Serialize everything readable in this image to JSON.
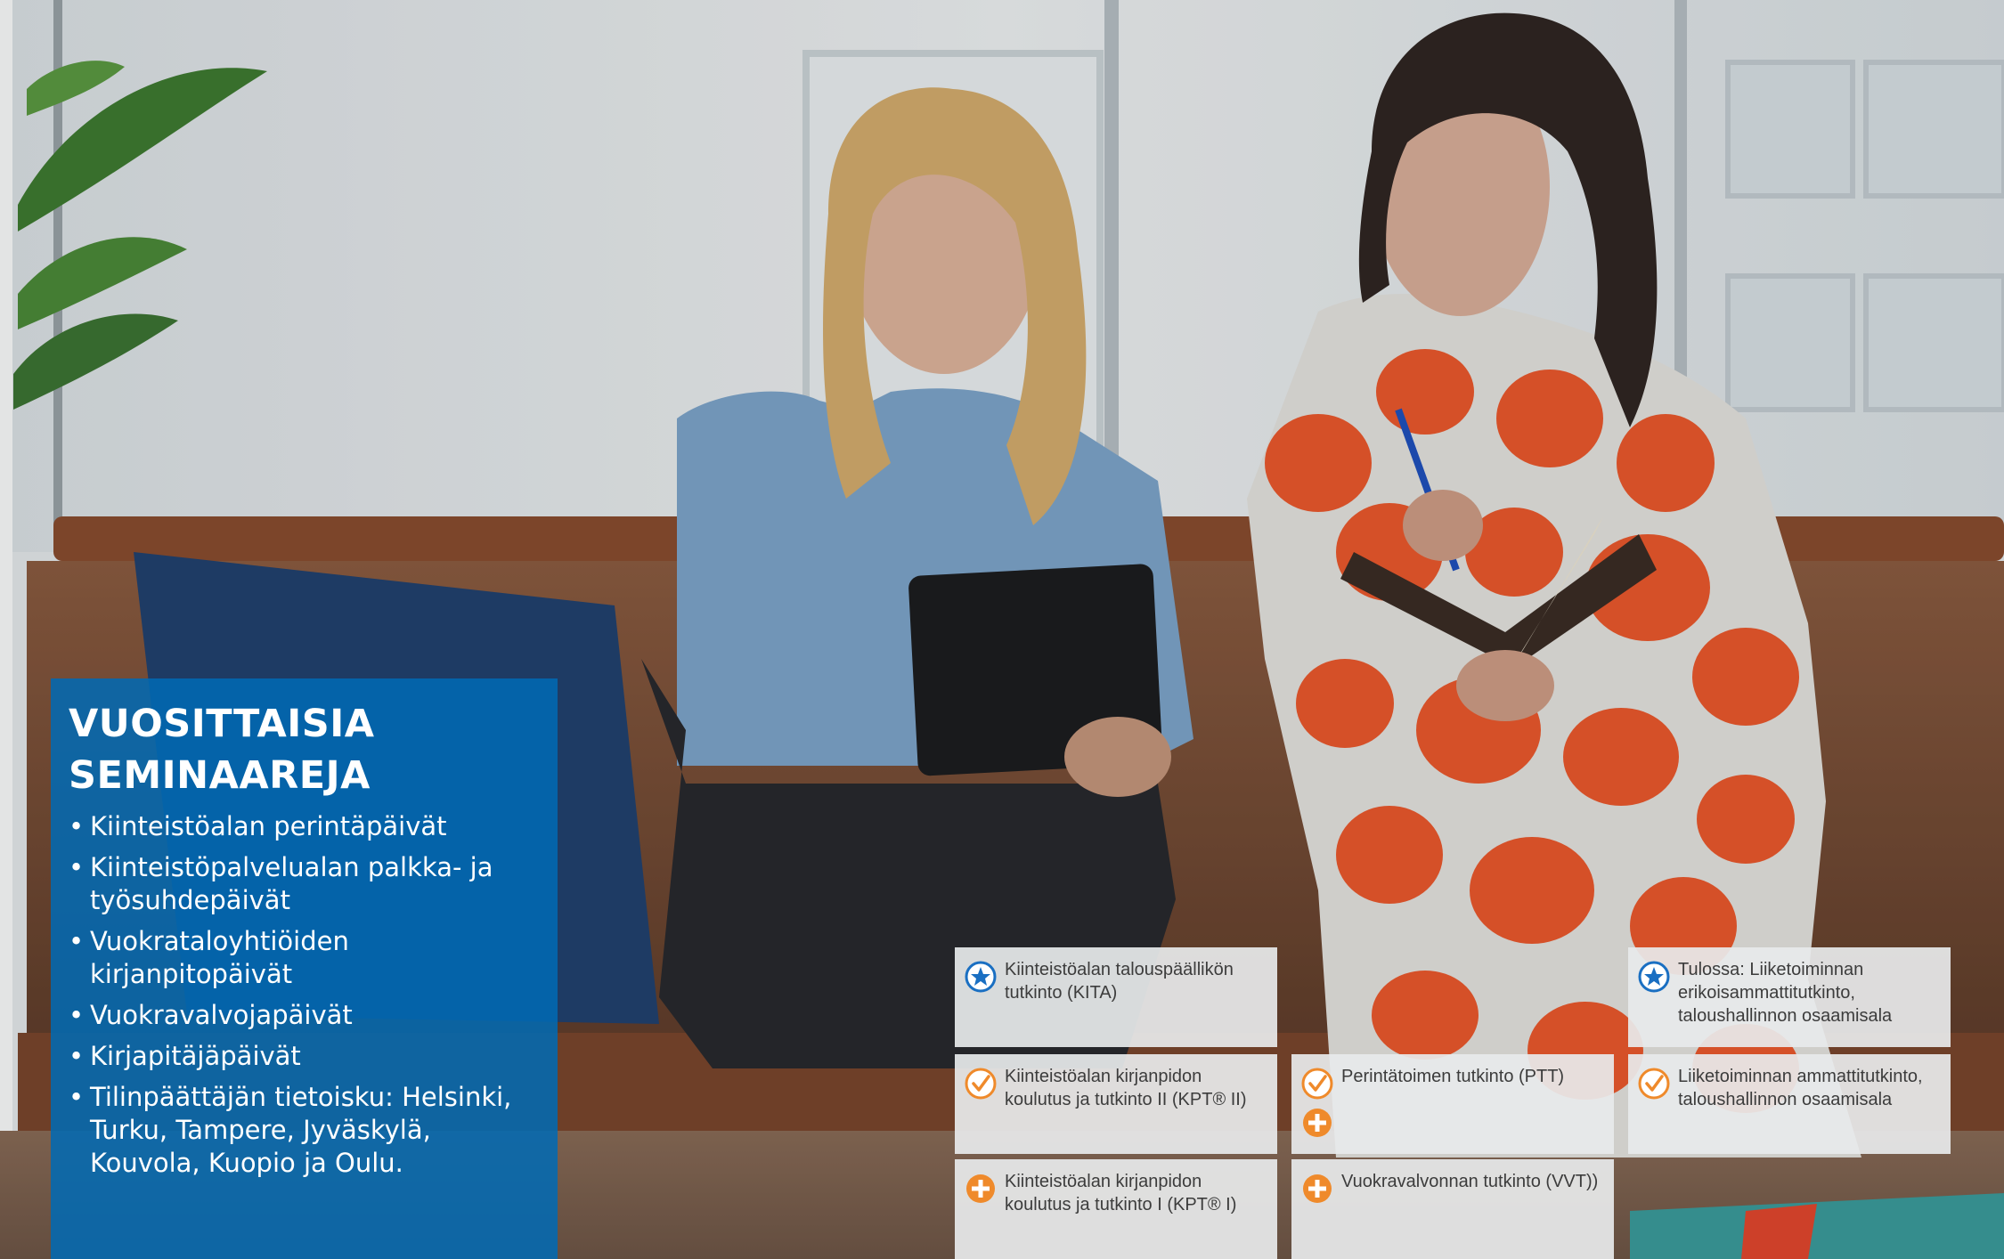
{
  "seminars": {
    "title_line1": "VUOSITTAISIA",
    "title_line2": "SEMINAAREJA",
    "items": [
      "Kiinteistöalan perintäpäivät",
      "Kiinteistöpalvelualan palkka- ja työsuhdepäivät",
      "Vuokrataloyhtiöiden kirjanpitopäivät",
      "Vuokravalvojapäivät",
      "Kirjapitäjäpäivät",
      "Tilinpäättäjän tietoisku: Helsinki, Turku, Tampere, Jyväskylä, Kouvola, Kuopio ja Oulu."
    ]
  },
  "degrees": [
    {
      "text": "Kiinteistöalan talouspäällikön tutkinto (KITA)",
      "icon": "star-icon"
    },
    {
      "text": "Tulossa: Liiketoiminnan erikoisammattitutkinto, taloushallinnon osaamisala",
      "icon": "star-icon"
    },
    {
      "text": "Kiinteistöalan kirjanpidon koulutus ja tutkinto II (KPT® II)",
      "icon": "check-icon"
    },
    {
      "text": "Perintätoimen tutkinto (PTT)",
      "icon": "check-icon",
      "icon2": "plus-icon"
    },
    {
      "text": "Liiketoiminnan ammattitutkinto, taloushallinnon osaamisala",
      "icon": "check-icon"
    },
    {
      "text": "Kiinteistöalan kirjanpidon koulutus ja tutkinto I (KPT® I)",
      "icon": "plus-icon"
    },
    {
      "text": "Vuokravalvonnan tutkinto (VVT))",
      "icon": "plus-icon"
    }
  ],
  "colors": {
    "panel_blue": "#0069b4",
    "star_blue": "#1a6fc2",
    "accent_orange": "#ef8a2b",
    "card_bg": "#e8eaec"
  }
}
